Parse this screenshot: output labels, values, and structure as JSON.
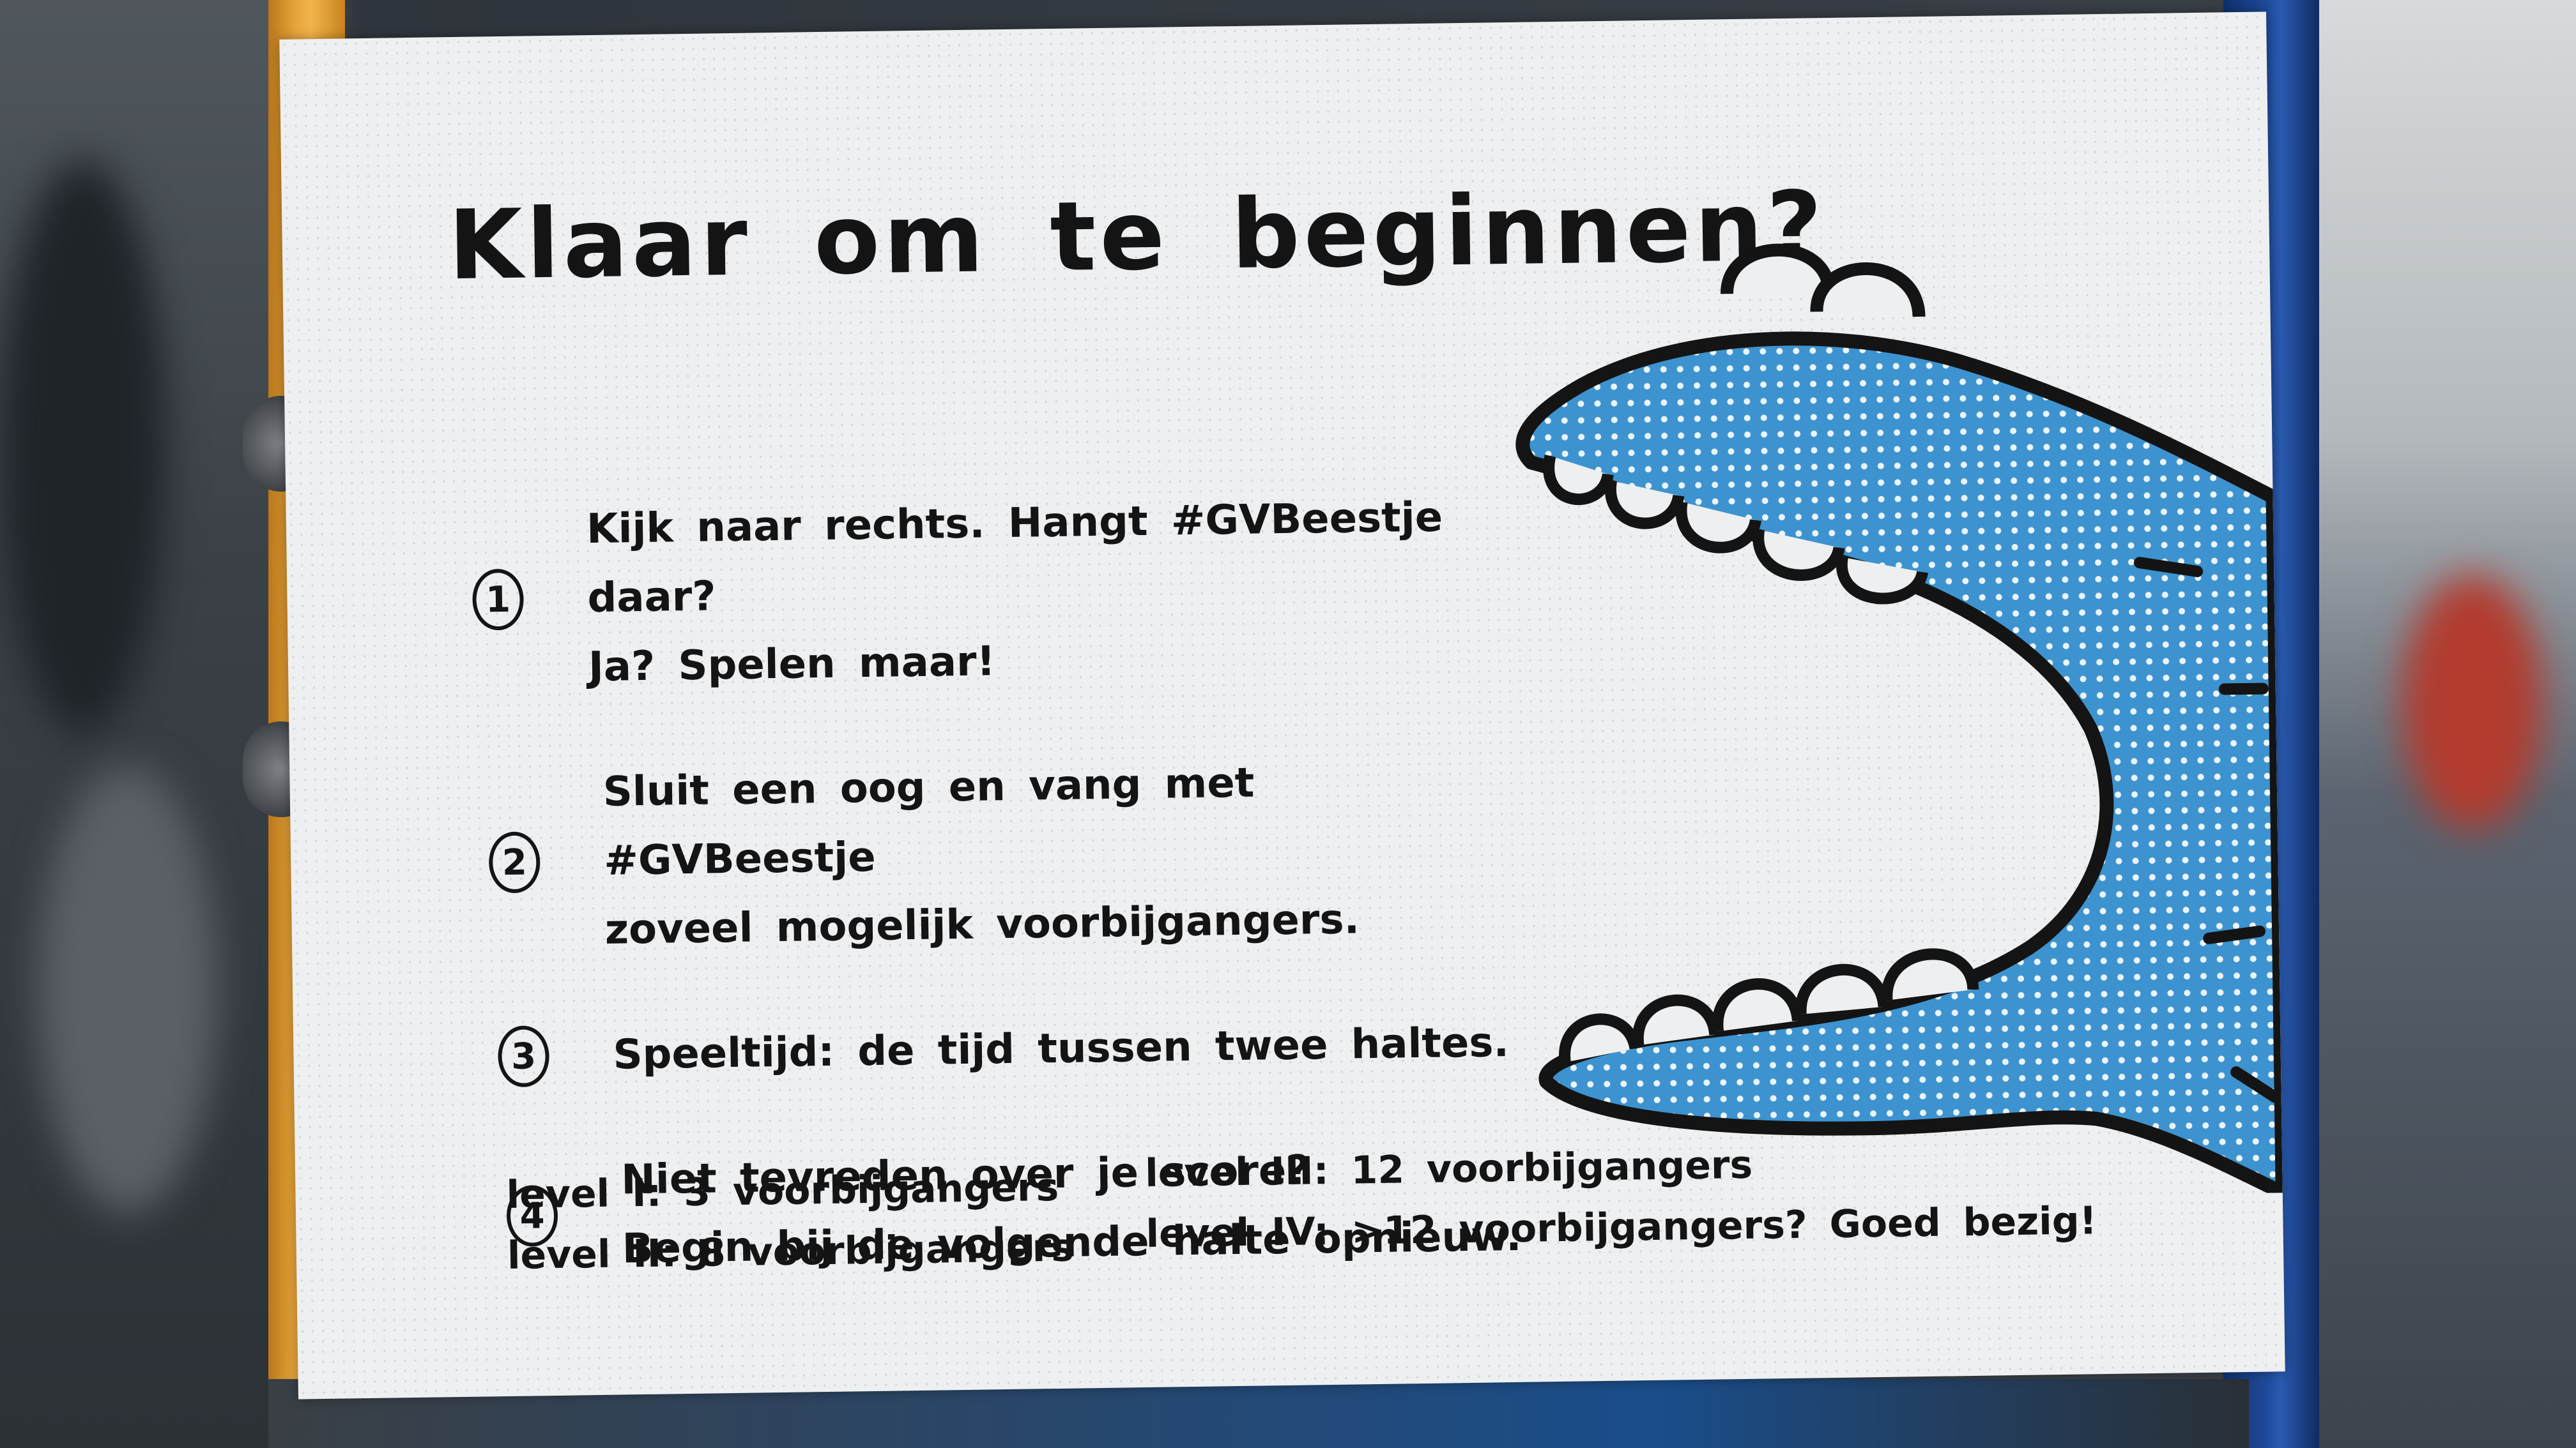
{
  "card": {
    "title": "Klaar om te beginnen?",
    "steps": [
      {
        "number": "1",
        "lines": [
          "Kijk naar rechts. Hangt #GVBeestje daar?",
          "Ja? Spelen maar!"
        ]
      },
      {
        "number": "2",
        "lines": [
          "Sluit een oog en vang met #GVBeestje",
          "zoveel mogelijk voorbijgangers."
        ]
      },
      {
        "number": "3",
        "lines": [
          "Speeltijd: de tijd tussen twee haltes."
        ]
      },
      {
        "number": "4",
        "lines": [
          "Niet tevreden over je score?",
          "Begin bij de volgende halte opnieuw."
        ]
      }
    ],
    "levels": {
      "level_1": "level I:  3 voorbijgangers",
      "level_2": "level II:  8 voorbijgangers",
      "level_3": "level III: 12 voorbijgangers",
      "level_4": "level IV: >12 voorbijgangers? Goed bezig!"
    }
  },
  "colors": {
    "creature_blue": "#3d93cf",
    "ink": "#141414",
    "card_background": "#eeeff0",
    "pole_yellow": "#e7a43a",
    "frame_blue": "#1f4a9a"
  },
  "icons": {
    "creature": "gvbeestje-creature-illustration"
  }
}
